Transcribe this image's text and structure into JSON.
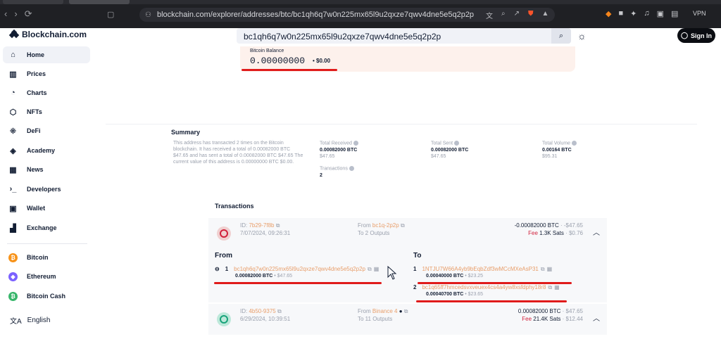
{
  "browser": {
    "url": "blockchain.com/explorer/addresses/btc/bc1qh6q7w0n225mx65l9u2qxze7qwv4dne5e5q2p2p",
    "vpn_label": "VPN"
  },
  "header": {
    "logo_text": "Blockchain.com",
    "search_value": "bc1qh6q7w0n225mx65l9u2qxze7qwv4dne5e5q2p2p",
    "signin_label": "Sign In"
  },
  "sidebar": {
    "items": [
      {
        "label": "Home",
        "icon": "home-icon"
      },
      {
        "label": "Prices",
        "icon": "prices-icon"
      },
      {
        "label": "Charts",
        "icon": "charts-icon"
      },
      {
        "label": "NFTs",
        "icon": "nft-icon"
      },
      {
        "label": "DeFi",
        "icon": "defi-icon"
      },
      {
        "label": "Academy",
        "icon": "academy-icon"
      },
      {
        "label": "News",
        "icon": "news-icon"
      },
      {
        "label": "Developers",
        "icon": "developers-icon"
      },
      {
        "label": "Wallet",
        "icon": "wallet-icon"
      },
      {
        "label": "Exchange",
        "icon": "exchange-icon"
      }
    ],
    "coins": [
      {
        "label": "Bitcoin",
        "color": "#f7931a",
        "symbol": "₿"
      },
      {
        "label": "Ethereum",
        "color": "#7b61ff",
        "symbol": "◆"
      },
      {
        "label": "Bitcoin Cash",
        "color": "#38b66b",
        "symbol": "₿"
      }
    ],
    "language": "English"
  },
  "balance": {
    "label": "Bitcoin Balance",
    "value": "0.00000000",
    "usd": "• $0.00"
  },
  "summary": {
    "title": "Summary",
    "description": "This address has transacted 2 times on the Bitcoin blockchain. It has received a total of 0.00082000 BTC $47.65 and has sent a total of 0.00082000 BTC $47.65 The current value of this address is 0.00000000 BTC $0.00.",
    "total_received_label": "Total Received",
    "total_received_btc": "0.00082000 BTC",
    "total_received_usd": "$47.65",
    "transactions_label": "Transactions",
    "transactions_value": "2",
    "total_sent_label": "Total Sent",
    "total_sent_btc": "0.00082000 BTC",
    "total_sent_usd": "$47.65",
    "total_volume_label": "Total Volume",
    "total_volume_btc": "0.00164 BTC",
    "total_volume_usd": "$95.31"
  },
  "transactions": {
    "title": "Transactions",
    "tx1": {
      "id_prefix": "ID: ",
      "id": "7b29-7f8b",
      "date": "7/07/2024, 09:26:31",
      "from_label": "From ",
      "from": "bc1q-2p2p",
      "to_label": "To ",
      "to": "2 Outputs",
      "amount": "-0.00082000 BTC",
      "amount_usd": " · -$47.65",
      "fee_label": "Fee ",
      "fee": "1.3K Sats",
      "fee_usd": " · $0.76"
    },
    "detail": {
      "from_heading": "From",
      "to_heading": "To",
      "from_index": "1",
      "from_address": "bc1qh6q7w0n225mx65l9u2qxze7qwv4dne5e5q2p2p",
      "from_amount": "0.00082000 BTC",
      "from_usd": " • $47.65",
      "to1_index": "1",
      "to1_address": "1NTJU7W66A4yb9bEqbZdf3wMCcMXeAsP31",
      "to1_amount": "0.00040000 BTC",
      "to1_usd": " • $23.25",
      "to2_index": "2",
      "to2_address": "bc1q65ff7hmcedsvxveuex4cs4a4yw8xsfdphy18r8",
      "to2_amount": "0.00040700 BTC",
      "to2_usd": " • $23.65"
    },
    "tx2": {
      "id_prefix": "ID: ",
      "id": "4b50-9375",
      "date": "6/29/2024, 10:39:51",
      "from_label": "From ",
      "from": "Binance 4",
      "to_label": "To ",
      "to": "11 Outputs",
      "amount": "0.00082000 BTC",
      "amount_usd": " · $47.65",
      "fee_label": "Fee ",
      "fee": "21.4K Sats",
      "fee_usd": " · $12.44"
    }
  },
  "colors": {
    "accent_orange": "#e89e6a",
    "red_underline": "#e01b1b",
    "balance_bg": "#fdf1ec"
  }
}
